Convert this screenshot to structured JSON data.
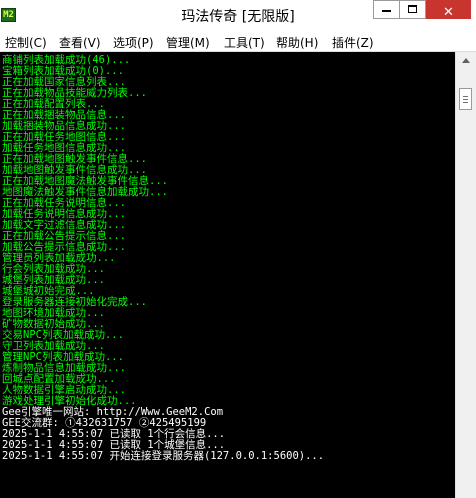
{
  "window": {
    "title": "玛法传奇 [无限版]",
    "icon": "app-icon",
    "icon_glyph": "M2",
    "minimize_icon": "minimize-icon",
    "maximize_icon": "maximize-icon",
    "close_glyph": "✕"
  },
  "menu": [
    {
      "label": "控制(C)"
    },
    {
      "label": "查看(V)"
    },
    {
      "label": "选项(P)"
    },
    {
      "label": "管理(M)"
    },
    {
      "label": "工具(T)"
    },
    {
      "label": "帮助(H)"
    },
    {
      "label": "插件(Z)"
    }
  ],
  "log": [
    {
      "text": "商铺列表加载成功(46)...",
      "color": "green"
    },
    {
      "text": "宝箱列表加载成功(0)...",
      "color": "green"
    },
    {
      "text": "正在加载国家信息列表...",
      "color": "green"
    },
    {
      "text": "正在加载物品技能威力列表...",
      "color": "green"
    },
    {
      "text": "正在加载配置列表...",
      "color": "green"
    },
    {
      "text": "正在加载捆装物品信息...",
      "color": "green"
    },
    {
      "text": "加载捆装物品信息成功...",
      "color": "green"
    },
    {
      "text": "正在加载任务地图信息...",
      "color": "green"
    },
    {
      "text": "加载任务地图信息成功...",
      "color": "green"
    },
    {
      "text": "正在加载地图触发事件信息...",
      "color": "green"
    },
    {
      "text": "加载地图触发事件信息成功...",
      "color": "green"
    },
    {
      "text": "正在加载地图魔法触发事件信息...",
      "color": "green"
    },
    {
      "text": "地图魔法触发事件信息加载成功...",
      "color": "green"
    },
    {
      "text": "正在加载任务说明信息...",
      "color": "green"
    },
    {
      "text": "加载任务说明信息成功...",
      "color": "green"
    },
    {
      "text": "加载文字过滤信息成功...",
      "color": "green"
    },
    {
      "text": "正在加载公告提示信息...",
      "color": "green"
    },
    {
      "text": "加载公告提示信息成功...",
      "color": "green"
    },
    {
      "text": "管理员列表加载成功...",
      "color": "green"
    },
    {
      "text": "行会列表加载成功...",
      "color": "green"
    },
    {
      "text": "城堡列表加载成功...",
      "color": "green"
    },
    {
      "text": "城堡城初始完成...",
      "color": "green"
    },
    {
      "text": "登录服务器连接初始化完成...",
      "color": "green"
    },
    {
      "text": "地图环境加载成功...",
      "color": "green"
    },
    {
      "text": "矿物数据初始成功...",
      "color": "green"
    },
    {
      "text": "交易NPC列表加载成功...",
      "color": "green"
    },
    {
      "text": "守卫列表加载成功...",
      "color": "green"
    },
    {
      "text": "管理NPC列表加载成功...",
      "color": "green"
    },
    {
      "text": "炼制物品信息加载成功...",
      "color": "green"
    },
    {
      "text": "回城点配置加载成功...",
      "color": "green"
    },
    {
      "text": "人物数据引擎启动成功...",
      "color": "green"
    },
    {
      "text": "游戏处理引擎初始化成功...",
      "color": "green"
    },
    {
      "text": "Gee引擎唯一网站: http://Www.GeeM2.Com",
      "color": "white"
    },
    {
      "text": "GEE交流群: ①432631757   ②425495199",
      "color": "white"
    },
    {
      "text": "2025-1-1 4:55:07 已读取 1个行会信息...",
      "color": "white"
    },
    {
      "text": "2025-1-1 4:55:07 已读取 1个城堡信息...",
      "color": "white"
    },
    {
      "text": "2025-1-1 4:55:07 开始连接登录服务器(127.0.0.1:5600)...",
      "color": "white"
    }
  ],
  "colors": {
    "log_background": "#000000",
    "log_green": "#00ff00",
    "log_white": "#ffffff",
    "close_button": "#c7352e"
  },
  "scrollbar": {
    "up_icon": "scroll-up-arrow-icon",
    "thumb_icon": "scroll-thumb"
  }
}
